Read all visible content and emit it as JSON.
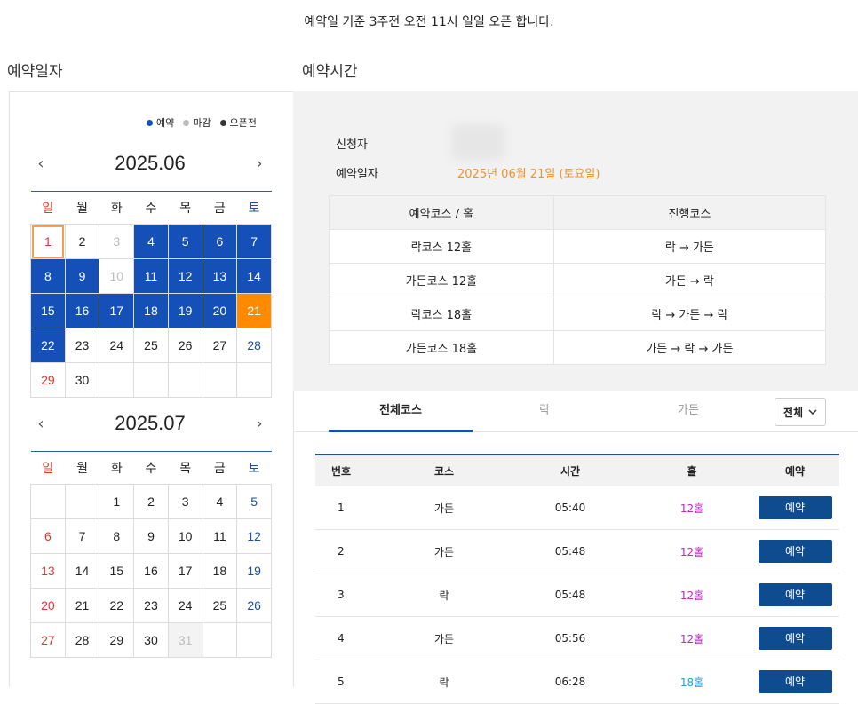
{
  "notice": "예약일 기준 3주전 오전 11시 일일 오픈 합니다.",
  "section_titles": {
    "date": "예약일자",
    "time": "예약시간"
  },
  "legend": [
    {
      "label": "예약",
      "color": "#1450b8"
    },
    {
      "label": "마감",
      "color": "#bbbbbb"
    },
    {
      "label": "오픈전",
      "color": "#333333"
    }
  ],
  "weekdays": [
    "일",
    "월",
    "화",
    "수",
    "목",
    "금",
    "토"
  ],
  "calendars": [
    {
      "month": "2025.06",
      "prev": "‹",
      "next": "›",
      "weeks": [
        [
          {
            "d": "1",
            "s": "today"
          },
          {
            "d": "2"
          },
          {
            "d": "3",
            "s": "closed"
          },
          {
            "d": "4",
            "s": "open"
          },
          {
            "d": "5",
            "s": "open"
          },
          {
            "d": "6",
            "s": "open"
          },
          {
            "d": "7",
            "s": "open"
          }
        ],
        [
          {
            "d": "8",
            "s": "open"
          },
          {
            "d": "9",
            "s": "open"
          },
          {
            "d": "10",
            "s": "closed"
          },
          {
            "d": "11",
            "s": "open"
          },
          {
            "d": "12",
            "s": "open"
          },
          {
            "d": "13",
            "s": "open"
          },
          {
            "d": "14",
            "s": "open"
          }
        ],
        [
          {
            "d": "15",
            "s": "open"
          },
          {
            "d": "16",
            "s": "open"
          },
          {
            "d": "17",
            "s": "open"
          },
          {
            "d": "18",
            "s": "open"
          },
          {
            "d": "19",
            "s": "open"
          },
          {
            "d": "20",
            "s": "open"
          },
          {
            "d": "21",
            "s": "sel"
          }
        ],
        [
          {
            "d": "22",
            "s": "open"
          },
          {
            "d": "23"
          },
          {
            "d": "24"
          },
          {
            "d": "25"
          },
          {
            "d": "26"
          },
          {
            "d": "27"
          },
          {
            "d": "28"
          }
        ],
        [
          {
            "d": "29"
          },
          {
            "d": "30"
          },
          {
            "d": ""
          },
          {
            "d": ""
          },
          {
            "d": ""
          },
          {
            "d": ""
          },
          {
            "d": ""
          }
        ]
      ]
    },
    {
      "month": "2025.07",
      "prev": "‹",
      "next": "›",
      "weeks": [
        [
          {
            "d": ""
          },
          {
            "d": ""
          },
          {
            "d": "1"
          },
          {
            "d": "2"
          },
          {
            "d": "3"
          },
          {
            "d": "4"
          },
          {
            "d": "5"
          }
        ],
        [
          {
            "d": "6"
          },
          {
            "d": "7"
          },
          {
            "d": "8"
          },
          {
            "d": "9"
          },
          {
            "d": "10"
          },
          {
            "d": "11"
          },
          {
            "d": "12"
          }
        ],
        [
          {
            "d": "13"
          },
          {
            "d": "14"
          },
          {
            "d": "15"
          },
          {
            "d": "16"
          },
          {
            "d": "17"
          },
          {
            "d": "18"
          },
          {
            "d": "19"
          }
        ],
        [
          {
            "d": "20"
          },
          {
            "d": "21"
          },
          {
            "d": "22"
          },
          {
            "d": "23"
          },
          {
            "d": "24"
          },
          {
            "d": "25"
          },
          {
            "d": "26"
          }
        ],
        [
          {
            "d": "27"
          },
          {
            "d": "28"
          },
          {
            "d": "29"
          },
          {
            "d": "30"
          },
          {
            "d": "31",
            "s": "past"
          },
          {
            "d": ""
          },
          {
            "d": ""
          }
        ]
      ]
    }
  ],
  "info": {
    "applicant_label": "신청자",
    "date_label": "예약일자",
    "date_value": "2025년 06월 21일 (토요일)"
  },
  "course_table": {
    "headers": [
      "예약코스 / 홀",
      "진행코스"
    ],
    "rows": [
      [
        "락코스 12홀",
        "락 → 가든"
      ],
      [
        "가든코스 12홀",
        "가든 → 락"
      ],
      [
        "락코스 18홀",
        "락 → 가든 → 락"
      ],
      [
        "가든코스 18홀",
        "가든 → 락 → 가든"
      ]
    ]
  },
  "tabs": [
    "전체코스",
    "락",
    "가든"
  ],
  "select": {
    "value": "전체",
    "icon": "chevron-down-icon"
  },
  "slots": {
    "headers": [
      "번호",
      "코스",
      "시간",
      "홀",
      "예약"
    ],
    "rows": [
      {
        "no": "1",
        "course": "가든",
        "time": "05:40",
        "hole": "12홀",
        "btn": "예약"
      },
      {
        "no": "2",
        "course": "가든",
        "time": "05:48",
        "hole": "12홀",
        "btn": "예약"
      },
      {
        "no": "3",
        "course": "락",
        "time": "05:48",
        "hole": "12홀",
        "btn": "예약"
      },
      {
        "no": "4",
        "course": "가든",
        "time": "05:56",
        "hole": "12홀",
        "btn": "예약"
      },
      {
        "no": "5",
        "course": "락",
        "time": "06:28",
        "hole": "18홀",
        "btn": "예약"
      }
    ]
  }
}
